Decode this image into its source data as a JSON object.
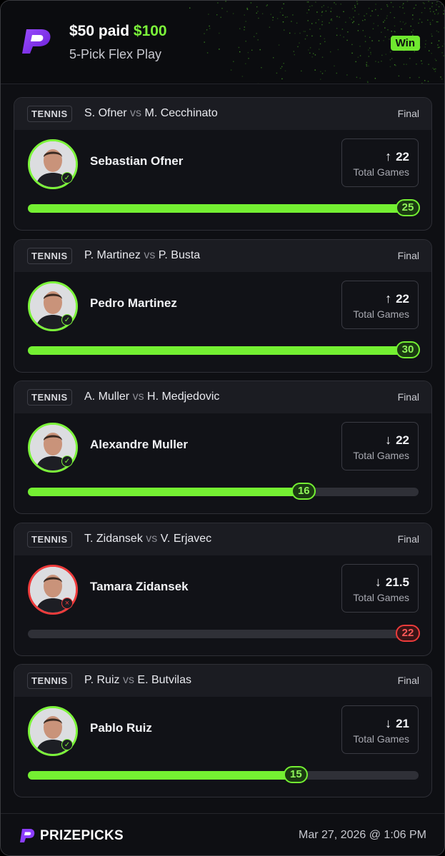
{
  "header": {
    "paid_label": "$50 paid",
    "won_amount": "$100",
    "play_type": "5-Pick Flex Play",
    "result_badge": "Win",
    "accent_color": "#7cf43a"
  },
  "picks": [
    {
      "sport": "TENNIS",
      "team_a": "S. Ofner",
      "vs": "vs",
      "team_b": "M. Cecchinato",
      "status": "Final",
      "player": "Sebastian Ofner",
      "direction_icon": "arrow-up-icon",
      "direction_glyph": "↑",
      "line": "22",
      "stat": "Total Games",
      "actual": "25",
      "result": "hit",
      "progress": 1.0
    },
    {
      "sport": "TENNIS",
      "team_a": "P. Martinez",
      "vs": "vs",
      "team_b": "P. Busta",
      "status": "Final",
      "player": "Pedro Martinez",
      "direction_icon": "arrow-up-icon",
      "direction_glyph": "↑",
      "line": "22",
      "stat": "Total Games",
      "actual": "30",
      "result": "hit",
      "progress": 1.0
    },
    {
      "sport": "TENNIS",
      "team_a": "A. Muller",
      "vs": "vs",
      "team_b": "H. Medjedovic",
      "status": "Final",
      "player": "Alexandre Muller",
      "direction_icon": "arrow-down-icon",
      "direction_glyph": "↓",
      "line": "22",
      "stat": "Total Games",
      "actual": "16",
      "result": "hit",
      "progress": 0.73
    },
    {
      "sport": "TENNIS",
      "team_a": "T. Zidansek",
      "vs": "vs",
      "team_b": "V. Erjavec",
      "status": "Final",
      "player": "Tamara Zidansek",
      "direction_icon": "arrow-down-icon",
      "direction_glyph": "↓",
      "line": "21.5",
      "stat": "Total Games",
      "actual": "22",
      "result": "miss",
      "progress": 1.0
    },
    {
      "sport": "TENNIS",
      "team_a": "P. Ruiz",
      "vs": "vs",
      "team_b": "E. Butvilas",
      "status": "Final",
      "player": "Pablo Ruiz",
      "direction_icon": "arrow-down-icon",
      "direction_glyph": "↓",
      "line": "21",
      "stat": "Total Games",
      "actual": "15",
      "result": "hit",
      "progress": 0.71
    }
  ],
  "footer": {
    "brand": "PRIZEPICKS",
    "timestamp": "Mar 27, 2026 @ 1:06 PM"
  }
}
